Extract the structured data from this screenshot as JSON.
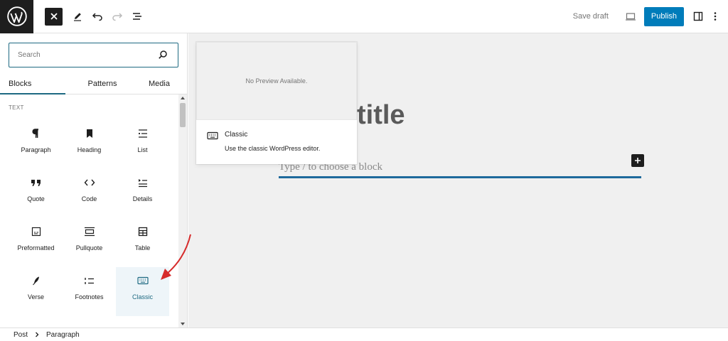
{
  "topbar": {
    "save_draft_label": "Save draft",
    "publish_label": "Publish"
  },
  "inserter": {
    "search_placeholder": "Search",
    "tabs": [
      {
        "label": "Blocks",
        "active": true
      },
      {
        "label": "Patterns",
        "active": false
      },
      {
        "label": "Media",
        "active": false
      }
    ],
    "category_label": "TEXT",
    "blocks": [
      {
        "label": "Paragraph",
        "icon": "paragraph-icon"
      },
      {
        "label": "Heading",
        "icon": "bookmark-icon"
      },
      {
        "label": "List",
        "icon": "list-icon"
      },
      {
        "label": "Quote",
        "icon": "quote-icon"
      },
      {
        "label": "Code",
        "icon": "code-icon"
      },
      {
        "label": "Details",
        "icon": "details-icon"
      },
      {
        "label": "Preformatted",
        "icon": "preformatted-icon"
      },
      {
        "label": "Pullquote",
        "icon": "pullquote-icon"
      },
      {
        "label": "Table",
        "icon": "table-icon"
      },
      {
        "label": "Verse",
        "icon": "feather-icon"
      },
      {
        "label": "Footnotes",
        "icon": "footnotes-icon"
      },
      {
        "label": "Classic",
        "icon": "keyboard-icon",
        "highlighted": true
      }
    ]
  },
  "canvas": {
    "title_partial": "title",
    "block_placeholder": "Type / to choose a block"
  },
  "preview": {
    "no_preview": "No Preview Available.",
    "block_name": "Classic",
    "block_description": "Use the classic WordPress editor."
  },
  "footer": {
    "breadcrumb": [
      "Post",
      "Paragraph"
    ]
  },
  "colors": {
    "accent": "#007cba",
    "highlight_text": "#1e6a82",
    "annotation_arrow": "#d62b2b"
  }
}
